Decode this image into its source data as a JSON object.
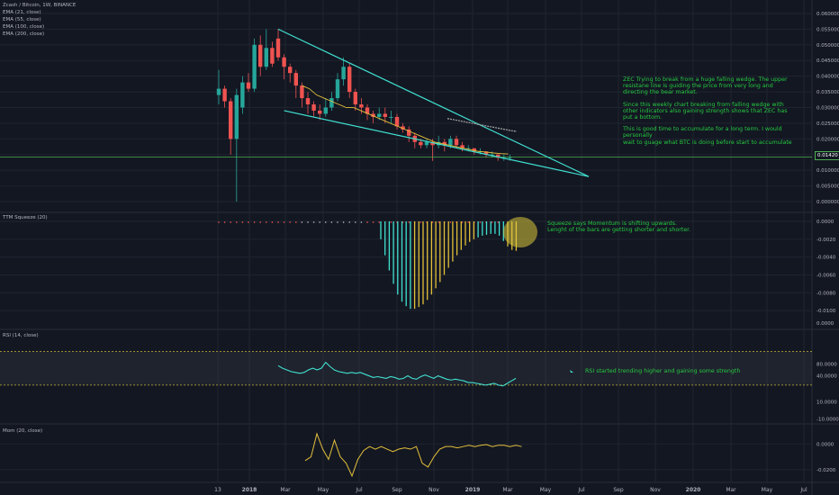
{
  "header": {
    "symbol_line": "Zcash / Bitcoin, 1W, BINANCE",
    "ema_labels": [
      "EMA (21, close)",
      "EMA (55, close)",
      "EMA (100, close)",
      "EMA (200, close)"
    ]
  },
  "panes": {
    "price": {
      "y_ticks": [
        "0.060000",
        "0.055000",
        "0.050000",
        "0.045000",
        "0.040000",
        "0.035000",
        "0.030000",
        "0.025000",
        "0.020000",
        "0.015000",
        "0.010000",
        "0.005000",
        "0.000000"
      ],
      "current_price": "0.01420"
    },
    "ttm": {
      "title": "TTM Squeeze (20)",
      "y_ticks": [
        "0.0000",
        "-0.0020",
        "-0.0040",
        "-0.0060",
        "-0.0080",
        "-0.0100",
        "0.0000"
      ]
    },
    "rsi": {
      "title": "RSI (14, close)",
      "y_ticks": [
        "80.0000",
        "40.0000",
        "10.0000",
        "-10.0000"
      ]
    },
    "mom": {
      "title": "Mom (20, close)",
      "y_ticks": [
        "0.0000",
        "-0.0200"
      ]
    }
  },
  "x_axis": [
    "13",
    "2018",
    "Mar",
    "May",
    "Jul",
    "Sep",
    "Nov",
    "2019",
    "Mar",
    "May",
    "Jul",
    "Sep",
    "Nov",
    "2020",
    "Mar",
    "May",
    "Jul"
  ],
  "annotations": {
    "wedge_note": [
      "ZEC Trying to break from a huge falling wedge. The upper",
      "resistane line is guiding the price from very long and",
      "directing the bear market.",
      "",
      "Since this weekly chart breaking from falling wedge with",
      "other indicators also gaining strength shows that ZEC has",
      "put a bottom.",
      "",
      "This is good time to accumulate for a long term. I would personally",
      "wait to guage what BTC is doing before start to accumulate"
    ],
    "squeeze_note": [
      "Squeeze says Momentum is shifting upwards.",
      "Lenght of the bars are getting shorter and shorter."
    ],
    "rsi_note": "RSI started trending higher and gaining some strength"
  },
  "colors": {
    "background": "#131722",
    "up_candle": "#26a69a",
    "down_candle": "#ef5350",
    "wedge": "#40e0d0",
    "ema21": "#e3c03a",
    "ema_long": "#9e9e9e",
    "annotation": "#26c940",
    "grid": "#1f2430",
    "axis_text": "#b2b5be"
  },
  "chart_data": [
    {
      "type": "candlestick",
      "title": "Zcash / Bitcoin, 1W, BINANCE",
      "ylim": [
        0,
        0.062
      ],
      "grid": true,
      "legend": "top-left",
      "candles": [
        [
          0.034,
          0.036,
          0.042,
          0.031
        ],
        [
          0.036,
          0.032,
          0.037,
          0.03
        ],
        [
          0.032,
          0.02,
          0.033,
          0.015
        ],
        [
          0.02,
          0.034,
          0.036,
          0.0
        ],
        [
          0.03,
          0.038,
          0.04,
          0.028
        ],
        [
          0.038,
          0.036,
          0.041,
          0.035
        ],
        [
          0.036,
          0.05,
          0.052,
          0.035
        ],
        [
          0.05,
          0.043,
          0.053,
          0.04
        ],
        [
          0.043,
          0.049,
          0.055,
          0.042
        ],
        [
          0.049,
          0.044,
          0.051,
          0.043
        ],
        [
          0.052,
          0.046,
          0.055,
          0.045
        ],
        [
          0.046,
          0.043,
          0.047,
          0.039
        ],
        [
          0.043,
          0.041,
          0.044,
          0.038
        ],
        [
          0.041,
          0.037,
          0.042,
          0.033
        ],
        [
          0.037,
          0.033,
          0.038,
          0.03
        ],
        [
          0.033,
          0.031,
          0.035,
          0.028
        ],
        [
          0.031,
          0.029,
          0.032,
          0.027
        ],
        [
          0.029,
          0.028,
          0.031,
          0.026
        ],
        [
          0.028,
          0.03,
          0.033,
          0.027
        ],
        [
          0.03,
          0.033,
          0.035,
          0.029
        ],
        [
          0.033,
          0.039,
          0.041,
          0.032
        ],
        [
          0.039,
          0.043,
          0.046,
          0.037
        ],
        [
          0.043,
          0.035,
          0.044,
          0.033
        ],
        [
          0.035,
          0.031,
          0.036,
          0.029
        ],
        [
          0.031,
          0.03,
          0.033,
          0.028
        ],
        [
          0.03,
          0.028,
          0.031,
          0.026
        ],
        [
          0.028,
          0.027,
          0.029,
          0.025
        ],
        [
          0.027,
          0.028,
          0.03,
          0.026
        ],
        [
          0.028,
          0.027,
          0.03,
          0.025
        ],
        [
          0.027,
          0.027,
          0.029,
          0.025
        ],
        [
          0.027,
          0.024,
          0.028,
          0.023
        ],
        [
          0.024,
          0.023,
          0.025,
          0.022
        ],
        [
          0.023,
          0.021,
          0.024,
          0.019
        ],
        [
          0.021,
          0.019,
          0.022,
          0.017
        ],
        [
          0.019,
          0.018,
          0.02,
          0.017
        ],
        [
          0.018,
          0.019,
          0.02,
          0.017
        ],
        [
          0.019,
          0.018,
          0.02,
          0.013
        ],
        [
          0.018,
          0.019,
          0.021,
          0.017
        ],
        [
          0.019,
          0.018,
          0.02,
          0.016
        ],
        [
          0.018,
          0.02,
          0.021,
          0.017
        ],
        [
          0.02,
          0.018,
          0.021,
          0.017
        ],
        [
          0.018,
          0.017,
          0.019,
          0.016
        ],
        [
          0.017,
          0.017,
          0.018,
          0.016
        ],
        [
          0.017,
          0.016,
          0.017,
          0.015
        ],
        [
          0.016,
          0.016,
          0.017,
          0.015
        ],
        [
          0.016,
          0.015,
          0.016,
          0.014
        ],
        [
          0.015,
          0.015,
          0.016,
          0.014
        ],
        [
          0.015,
          0.014,
          0.015,
          0.013
        ],
        [
          0.014,
          0.014,
          0.015,
          0.013
        ],
        [
          0.014,
          0.0142,
          0.015,
          0.013
        ]
      ],
      "trendlines": [
        {
          "name": "upper resistance",
          "x": [
            10,
            60
          ],
          "y": [
            0.055,
            0.01
          ]
        },
        {
          "name": "lower support",
          "x": [
            11,
            60
          ],
          "y": [
            0.029,
            0.01
          ]
        }
      ],
      "ema_21": [
        0.037,
        0.036,
        0.034,
        0.033,
        0.032,
        0.031,
        0.03,
        0.03,
        0.029,
        0.028,
        0.027,
        0.026,
        0.025,
        0.024,
        0.023,
        0.022,
        0.021,
        0.02,
        0.019,
        0.0185,
        0.018,
        0.0175,
        0.017,
        0.0165,
        0.016,
        0.0158,
        0.0155,
        0.0153,
        0.0152
      ],
      "ema_long": [
        0.0265,
        0.0262,
        0.0259,
        0.0256,
        0.0253,
        0.025,
        0.0247,
        0.0244,
        0.0241,
        0.0238,
        0.0235,
        0.0232,
        0.0229,
        0.0226,
        0.0224
      ]
    },
    {
      "type": "bar",
      "title": "TTM Squeeze (20)",
      "ylim": [
        -0.0115,
        0.0005
      ],
      "values": [
        -0.002,
        -0.0038,
        -0.0055,
        -0.007,
        -0.0082,
        -0.009,
        -0.0095,
        -0.0098,
        -0.0098,
        -0.0096,
        -0.0093,
        -0.0088,
        -0.0082,
        -0.0075,
        -0.0068,
        -0.006,
        -0.0052,
        -0.0045,
        -0.0038,
        -0.0032,
        -0.0027,
        -0.0023,
        -0.002,
        -0.0018,
        -0.0016,
        -0.0015,
        -0.0014,
        -0.0014,
        -0.0016,
        -0.0022,
        -0.0028,
        -0.0032,
        -0.0033
      ]
    },
    {
      "type": "line",
      "title": "RSI (14, close)",
      "ylim": [
        -15,
        95
      ],
      "values": [
        53,
        50,
        48,
        46,
        45,
        44,
        45,
        48,
        50,
        48,
        50,
        57,
        52,
        48,
        46,
        45,
        44,
        45,
        44,
        45,
        43,
        41,
        39,
        40,
        39,
        38,
        40,
        39,
        37,
        38,
        41,
        38,
        37,
        40,
        42,
        40,
        38,
        41,
        39,
        37,
        36,
        37,
        36,
        35,
        33,
        33,
        32,
        31,
        30,
        31,
        32,
        30,
        29,
        32,
        35,
        38
      ]
    },
    {
      "type": "line",
      "title": "Mom (20, close)",
      "ylim": [
        -0.03,
        0.015
      ],
      "values": [
        -0.013,
        -0.01,
        0.008,
        -0.004,
        -0.012,
        0.003,
        -0.01,
        -0.015,
        -0.025,
        -0.012,
        -0.005,
        -0.002,
        -0.004,
        -0.002,
        -0.004,
        -0.006,
        -0.004,
        -0.003,
        -0.004,
        -0.002,
        -0.015,
        -0.018,
        -0.01,
        -0.004,
        -0.002,
        -0.002,
        -0.003,
        -0.002,
        -0.001,
        -0.002,
        -0.001,
        -0.0005,
        -0.002,
        -0.001,
        -0.001,
        -0.002,
        -0.001,
        -0.002
      ]
    }
  ]
}
